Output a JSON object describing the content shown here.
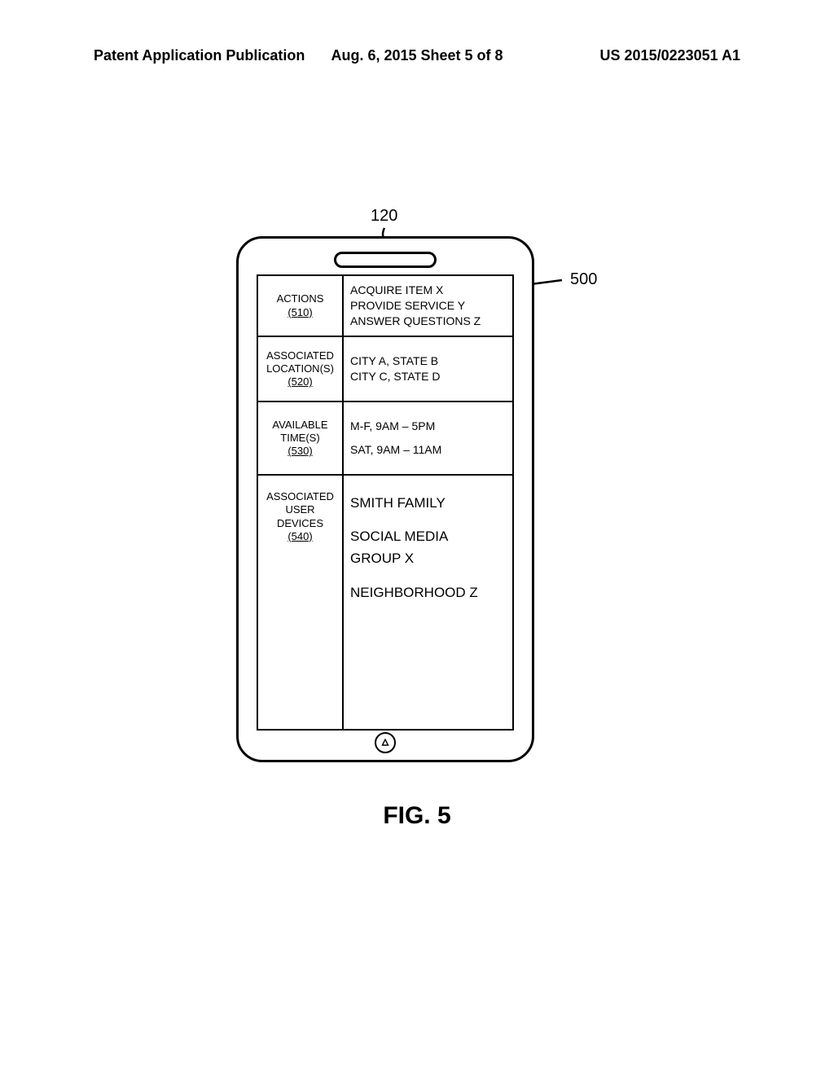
{
  "header": {
    "left": "Patent Application Publication",
    "center": "Aug. 6, 2015  Sheet 5 of 8",
    "right": "US 2015/0223051 A1"
  },
  "labels": {
    "device_ref": "120",
    "callout_500": "500"
  },
  "rows": {
    "actions": {
      "title": "ACTIONS",
      "num": "(510)",
      "l1": "ACQUIRE ITEM X",
      "l2": "PROVIDE SERVICE Y",
      "l3": "ANSWER QUESTIONS Z"
    },
    "locations": {
      "title1": "ASSOCIATED",
      "title2": "LOCATION(S)",
      "num": "(520)",
      "l1": "CITY A, STATE B",
      "l2": "CITY C, STATE D"
    },
    "times": {
      "title1": "AVAILABLE",
      "title2": "TIME(S)",
      "num": "(530)",
      "l1": "M-F, 9AM – 5PM",
      "l2": "SAT, 9AM – 11AM"
    },
    "devices": {
      "title1": "ASSOCIATED",
      "title2": "USER",
      "title3": "DEVICES",
      "num": "(540)",
      "l1": "SMITH FAMILY",
      "l2": "SOCIAL MEDIA",
      "l3": "GROUP X",
      "l4": "NEIGHBORHOOD Z"
    }
  },
  "figure_caption": "FIG. 5"
}
